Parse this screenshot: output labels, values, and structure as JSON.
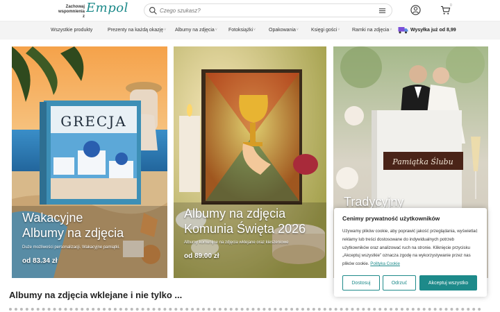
{
  "header": {
    "logo_small": "Zachowaj wspomnienia z",
    "logo_script": "Empol",
    "search_placeholder": "Czego szukasz?",
    "cart_count": "0"
  },
  "nav": {
    "items": [
      {
        "label": "Wszystkie produkty",
        "caret": false
      },
      {
        "label": "Prezenty na każdą okazję",
        "caret": true
      },
      {
        "label": "Albumy na zdjęcia",
        "caret": true
      },
      {
        "label": "Fotoksiążki",
        "caret": true
      },
      {
        "label": "Opakowania",
        "caret": true
      },
      {
        "label": "Księgi gości",
        "caret": true
      },
      {
        "label": "Ramki na zdjęcia",
        "caret": true
      }
    ],
    "shipping": "Wysyłka już od 8,99"
  },
  "cards": [
    {
      "title_line1": "Wakacyjne",
      "title_line2": "Albumy na zdjęcia",
      "sub": "Duże możliwości personalizacji. Wakacyjne pamiątki.",
      "price": "od 83.34 zł",
      "book_text": "GRECJA"
    },
    {
      "title_line1": "Albumy na zdjęcia",
      "title_line2": "Komunia Święta 2026",
      "sub": "Albumy komunijne na zdjęcia wklejane oraz kieszeniowe",
      "price": "od 89.00 zł"
    },
    {
      "title_line1": "Tradycyjny",
      "title_line2": "",
      "sub": "",
      "price": "",
      "book_text": "Pamiątka Ślubu"
    }
  ],
  "main": {
    "heading": "Albumy na zdjęcia wklejane i nie tylko ..."
  },
  "cookie": {
    "title": "Cenimy prywatność użytkowników",
    "body": "Używamy plików cookie, aby poprawić jakość przeglądania, wyświetlać reklamy lub treści dostosowane do indywidualnych potrzeb użytkowników oraz analizować ruch na stronie. Kliknięcie przycisku „Akceptuj wszystkie” oznacza zgodę na wykorzystywanie przez nas plików cookie.",
    "link": "Polityka Cookie",
    "btn_customize": "Dostosuj",
    "btn_reject": "Odrzuć",
    "btn_accept": "Akceptuj wszystko"
  },
  "colors": {
    "accent": "#1d8a8a",
    "nav_bg": "#f4f4f4"
  }
}
